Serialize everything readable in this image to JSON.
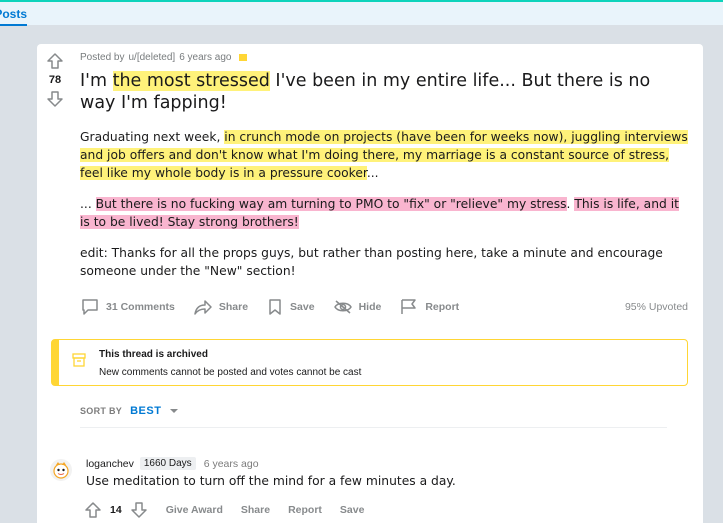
{
  "topbar": {
    "tab_label": "Posts"
  },
  "post": {
    "score": "78",
    "meta": {
      "posted_by": "Posted by",
      "author": "u/[deleted]",
      "time": "6 years ago"
    },
    "title": {
      "t1": "I'm ",
      "t2": "the most stressed",
      "t3": " I've been in my entire life... But there is no way I'm fapping!"
    },
    "body": {
      "p1": {
        "a": "Graduating next week, ",
        "b": "in crunch mode on projects (have been for weeks now), juggling interviews and job offers and don't know what I'm doing there, my marriage is a constant source of stress, feel like my whole body is in a pressure cooker",
        "c": "..."
      },
      "p2": {
        "a": "... ",
        "b": "But there is no fucking way am turning to PMO to \"fix\" or \"relieve\" my stress",
        "c": ". ",
        "d": "This is life, and it is to be lived! Stay strong brothers!"
      },
      "p3": "edit: Thanks for all the props guys, but rather than posting here, take a minute and encourage someone under the \"New\" section!"
    },
    "actions": {
      "comments": "31 Comments",
      "share": "Share",
      "save": "Save",
      "hide": "Hide",
      "report": "Report",
      "upvoted": "95% Upvoted"
    }
  },
  "archived": {
    "heading": "This thread is archived",
    "subtext": "New comments cannot be posted and votes cannot be cast"
  },
  "sort": {
    "label": "SORT BY",
    "value": "BEST"
  },
  "comment": {
    "user": "loganchev",
    "flair": "1660 Days",
    "time": "6 years ago",
    "text": "Use meditation to turn off the mind for a few minutes a day.",
    "score": "14",
    "actions": {
      "give_award": "Give Award",
      "share": "Share",
      "report": "Report",
      "save": "Save"
    }
  },
  "colors": {
    "accent": "#0079d3",
    "highlight_yellow": "#fff27a",
    "highlight_pink": "#f9b5cf",
    "archive_border": "#ffd635"
  }
}
